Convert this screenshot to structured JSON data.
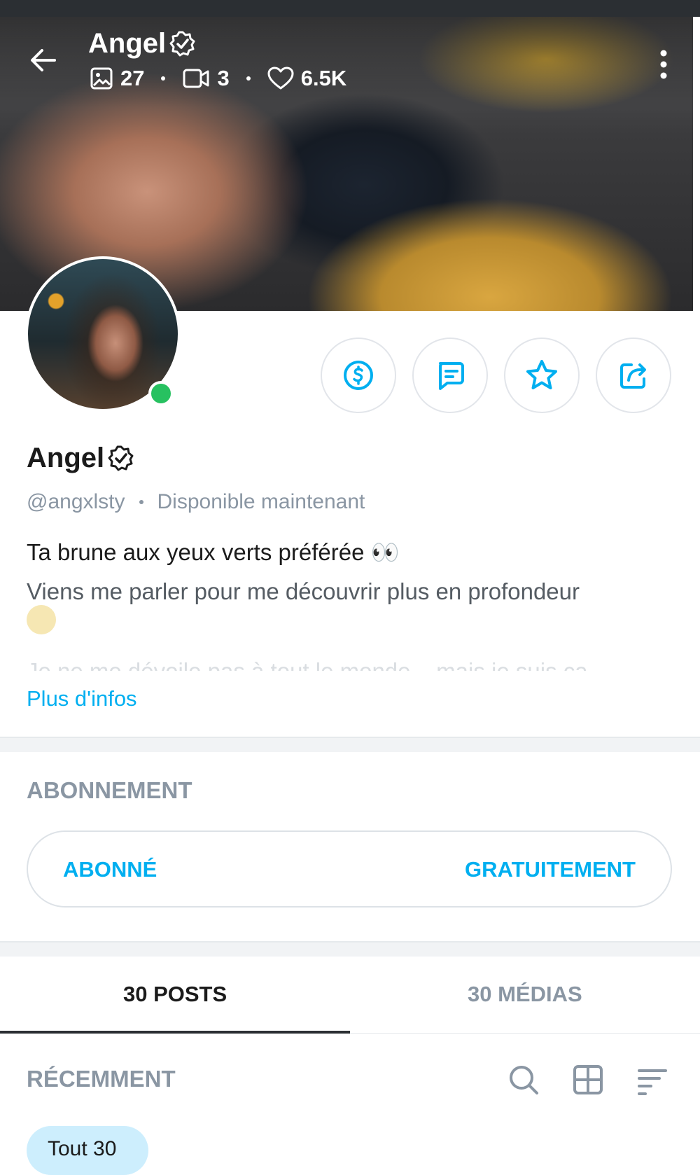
{
  "header": {
    "title": "Angel",
    "stats": {
      "photos": "27",
      "videos": "3",
      "likes": "6.5K"
    }
  },
  "profile": {
    "name": "Angel",
    "handle": "@angxlsty",
    "status": "Disponible maintenant",
    "bio_line1": "Ta brune aux yeux verts préférée 👀",
    "bio_line2": "Viens me parler pour me découvrir plus en profondeur",
    "bio_line3_faded": "Je ne me dévoile pas à tout le monde... mais je suis ca",
    "more_link": "Plus d'infos",
    "actions": [
      "dollar-icon",
      "message-icon",
      "star-icon",
      "share-icon"
    ]
  },
  "subscription": {
    "section_title": "ABONNEMENT",
    "button_left": "ABONNÉ",
    "button_right": "GRATUITEMENT"
  },
  "tabs": [
    {
      "label": "30 POSTS",
      "active": true
    },
    {
      "label": "30 MÉDIAS",
      "active": false
    }
  ],
  "recent": {
    "title": "RÉCEMMENT",
    "filter_chip": "Tout 30"
  },
  "colors": {
    "accent": "#00aff0",
    "muted": "#8a96a3",
    "online": "#27c160"
  }
}
